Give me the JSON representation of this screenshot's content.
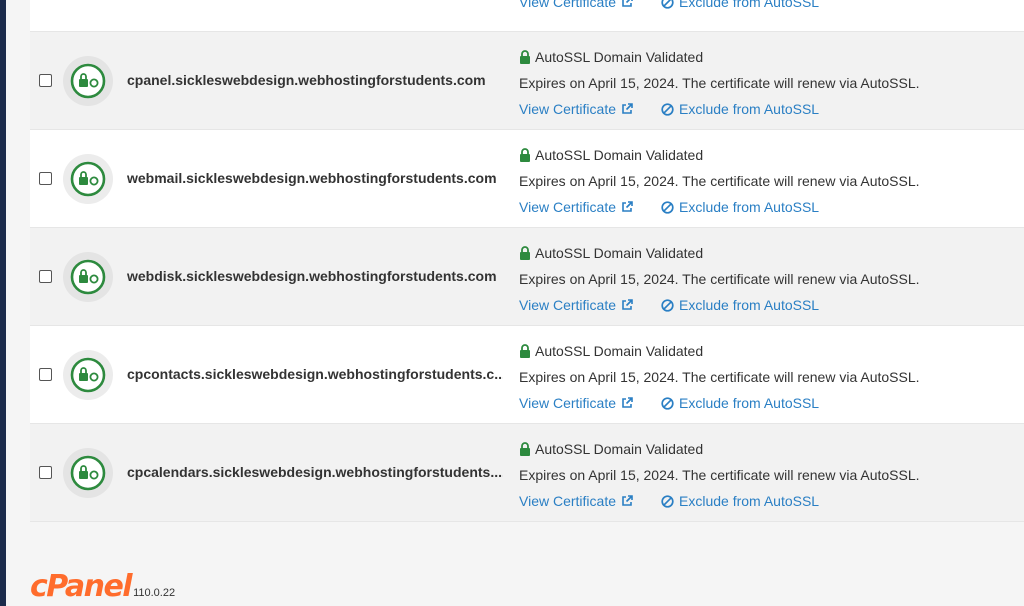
{
  "colors": {
    "accent": "#2a7fc4",
    "status_green": "#2d8a3e",
    "brand": "#ff6c2c"
  },
  "top_row": {
    "view_label": "View Certificate",
    "exclude_label": "Exclude from AutoSSL"
  },
  "rows": [
    {
      "domain": "cpanel.sickleswebdesign.webhostingforstudents.com",
      "status": "AutoSSL Domain Validated",
      "expires": "Expires on April 15, 2024. The certificate will renew via AutoSSL.",
      "view_label": "View Certificate",
      "exclude_label": "Exclude from AutoSSL"
    },
    {
      "domain": "webmail.sickleswebdesign.webhostingforstudents.com",
      "status": "AutoSSL Domain Validated",
      "expires": "Expires on April 15, 2024. The certificate will renew via AutoSSL.",
      "view_label": "View Certificate",
      "exclude_label": "Exclude from AutoSSL"
    },
    {
      "domain": "webdisk.sickleswebdesign.webhostingforstudents.com",
      "status": "AutoSSL Domain Validated",
      "expires": "Expires on April 15, 2024. The certificate will renew via AutoSSL.",
      "view_label": "View Certificate",
      "exclude_label": "Exclude from AutoSSL"
    },
    {
      "domain": "cpcontacts.sickleswebdesign.webhostingforstudents.c...",
      "status": "AutoSSL Domain Validated",
      "expires": "Expires on April 15, 2024. The certificate will renew via AutoSSL.",
      "view_label": "View Certificate",
      "exclude_label": "Exclude from AutoSSL"
    },
    {
      "domain": "cpcalendars.sickleswebdesign.webhostingforstudents....",
      "status": "AutoSSL Domain Validated",
      "expires": "Expires on April 15, 2024. The certificate will renew via AutoSSL.",
      "view_label": "View Certificate",
      "exclude_label": "Exclude from AutoSSL"
    }
  ],
  "footer": {
    "logo": "cPanel",
    "version": "110.0.22"
  },
  "icons": {
    "row_badge": "lock-sync-icon",
    "status": "lock-icon",
    "view": "external-link-icon",
    "exclude": "ban-icon"
  }
}
